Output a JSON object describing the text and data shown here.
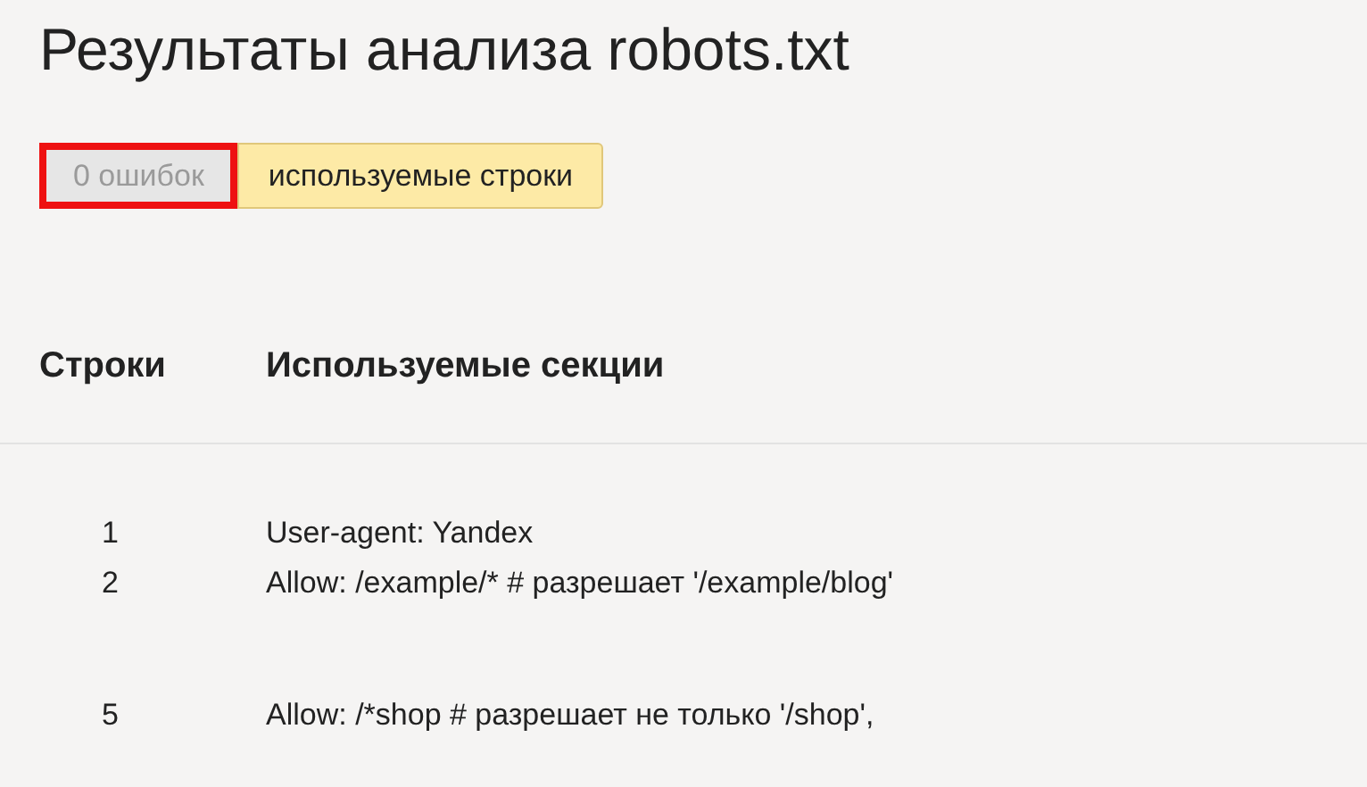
{
  "title": "Результаты анализа robots.txt",
  "filters": [
    {
      "label": "0 ошибок",
      "selected": false,
      "disabled": true,
      "highlighted": true
    },
    {
      "label": "используемые строки",
      "selected": true,
      "disabled": false,
      "highlighted": false
    }
  ],
  "table": {
    "columns": [
      "Строки",
      "Используемые секции"
    ],
    "groups": [
      {
        "rows": [
          {
            "line": "1",
            "text": "User-agent: Yandex"
          },
          {
            "line": "2",
            "text": "Allow: /example/* # разрешает '/example/blog'"
          }
        ]
      },
      {
        "rows": [
          {
            "line": "5",
            "text": "Allow: /*shop # разрешает не только '/shop',"
          }
        ]
      }
    ]
  }
}
